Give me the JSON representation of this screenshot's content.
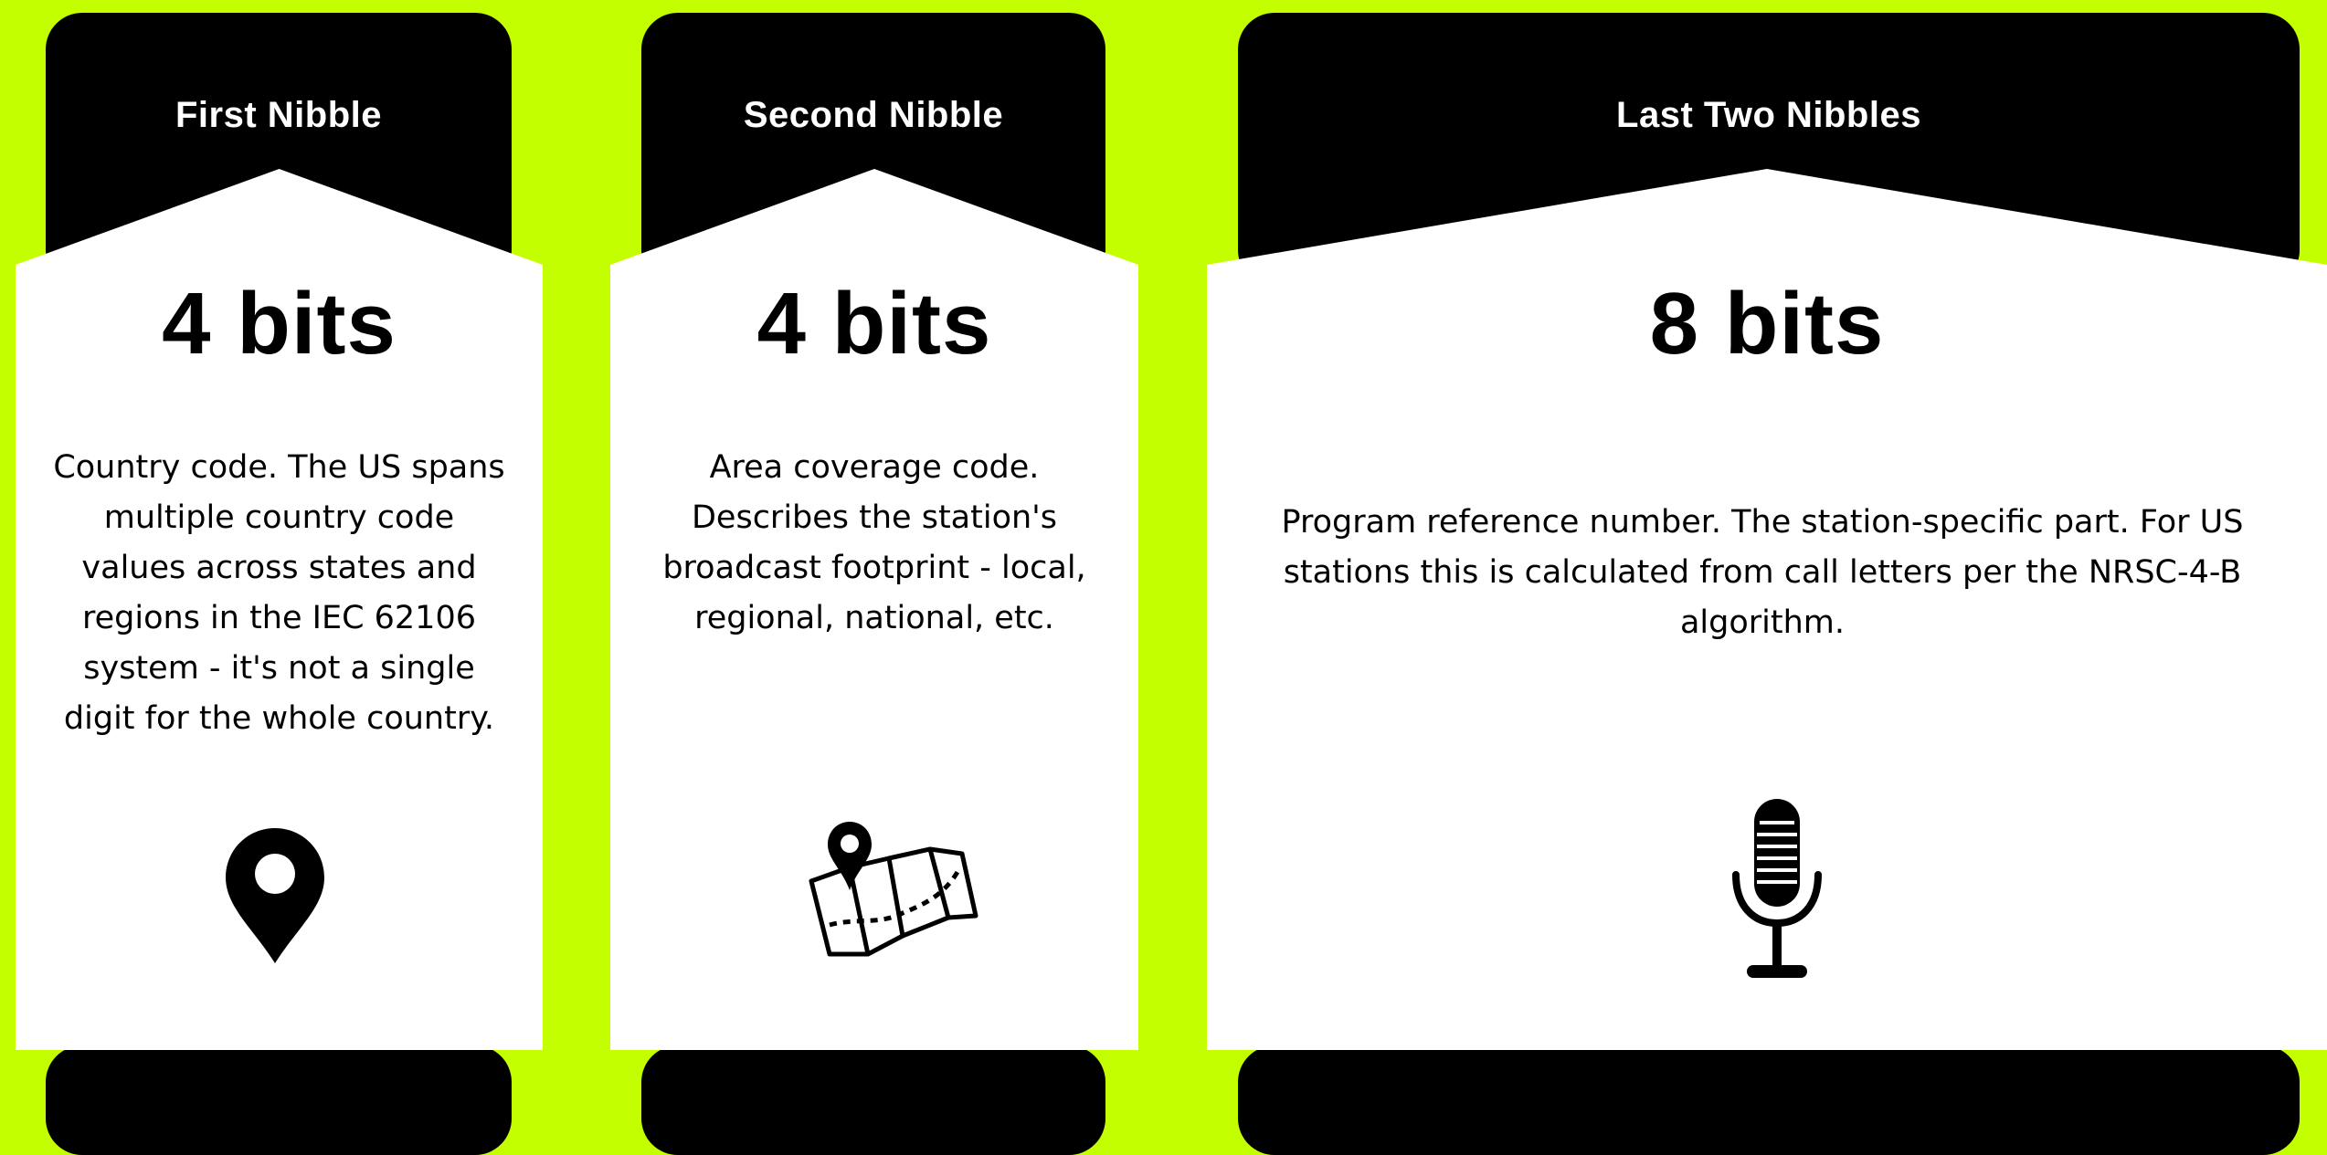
{
  "cards": [
    {
      "title": "First Nibble",
      "bits": "4 bits",
      "description": "Country code. The US spans multiple country code values across states and regions in the IEC 62106 system - it's not a single digit for the whole country.",
      "icon": "location-pin-icon"
    },
    {
      "title": "Second Nibble",
      "bits": "4 bits",
      "description": "Area coverage code. Describes the station's broadcast footprint - local, regional, national, etc.",
      "icon": "map-icon"
    },
    {
      "title": "Last Two Nibbles",
      "bits": "8 bits",
      "description": "Program reference number. The station-specific part. For US stations this is calculated from call letters per the NRSC-4-B algorithm.",
      "icon": "microphone-icon"
    }
  ],
  "colors": {
    "background": "#c4ff00",
    "header": "#000000",
    "body": "#ffffff"
  }
}
